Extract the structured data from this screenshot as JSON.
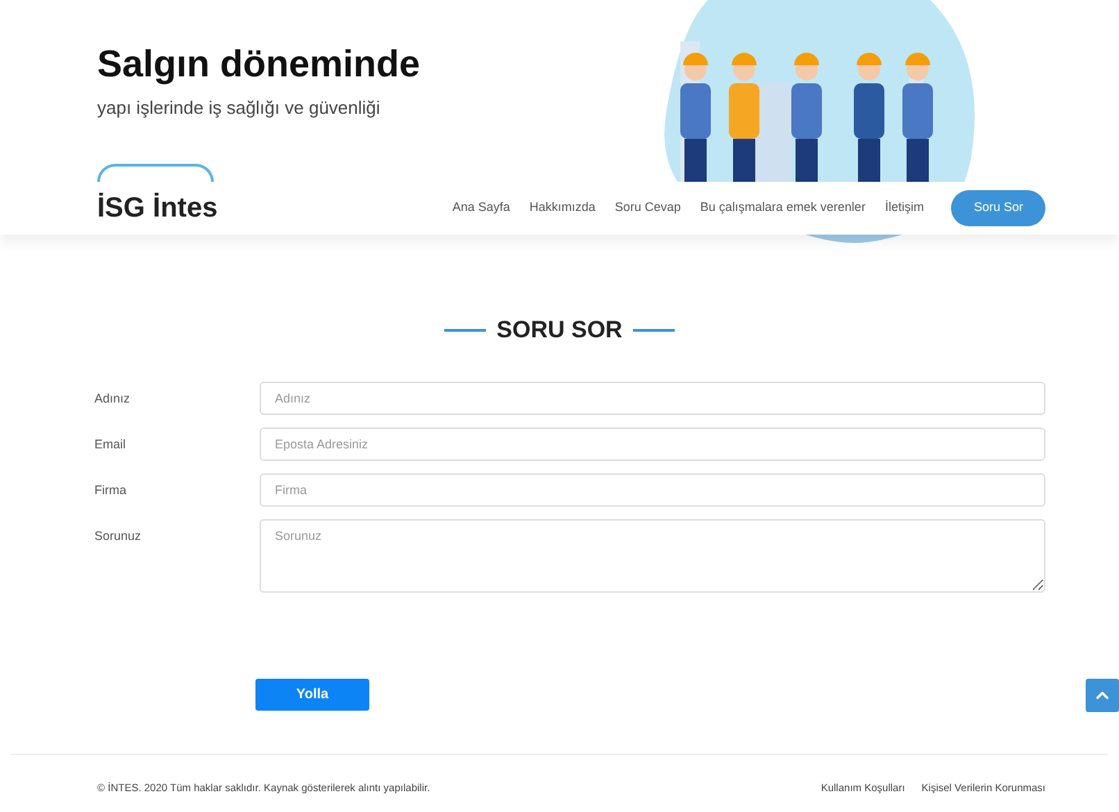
{
  "hero": {
    "title": "Salgın döneminde",
    "subtitle": "yapı işlerinde iş sağlığı ve güvenliği"
  },
  "header": {
    "logo": "İSG İntes",
    "nav": [
      {
        "label": "Ana Sayfa",
        "kind": "link"
      },
      {
        "label": "Hakkımızda",
        "kind": "link"
      },
      {
        "label": "Soru Cevap",
        "kind": "link"
      },
      {
        "label": "Bu çalışmalara emek verenler",
        "kind": "link"
      },
      {
        "label": "İletişim",
        "kind": "link"
      },
      {
        "label": "Soru Sor",
        "kind": "button"
      }
    ]
  },
  "form": {
    "title": "SORU SOR",
    "fields": [
      {
        "label": "Adınız",
        "placeholder": "Adınız",
        "kind": "input"
      },
      {
        "label": "Email",
        "placeholder": "Eposta Adresiniz",
        "kind": "input"
      },
      {
        "label": "Firma",
        "placeholder": "Firma",
        "kind": "input"
      },
      {
        "label": "Sorunuz",
        "placeholder": "Sorunuz",
        "kind": "textarea"
      }
    ],
    "submit": "Yolla"
  },
  "footer": {
    "copyright": "© İNTES. 2020 Tüm haklar saklıdır. Kaynak gösterilerek alıntı yapılabilir.",
    "links": [
      "Kullanım Koşulları",
      "Kişisel Verilerin Korunması"
    ]
  }
}
